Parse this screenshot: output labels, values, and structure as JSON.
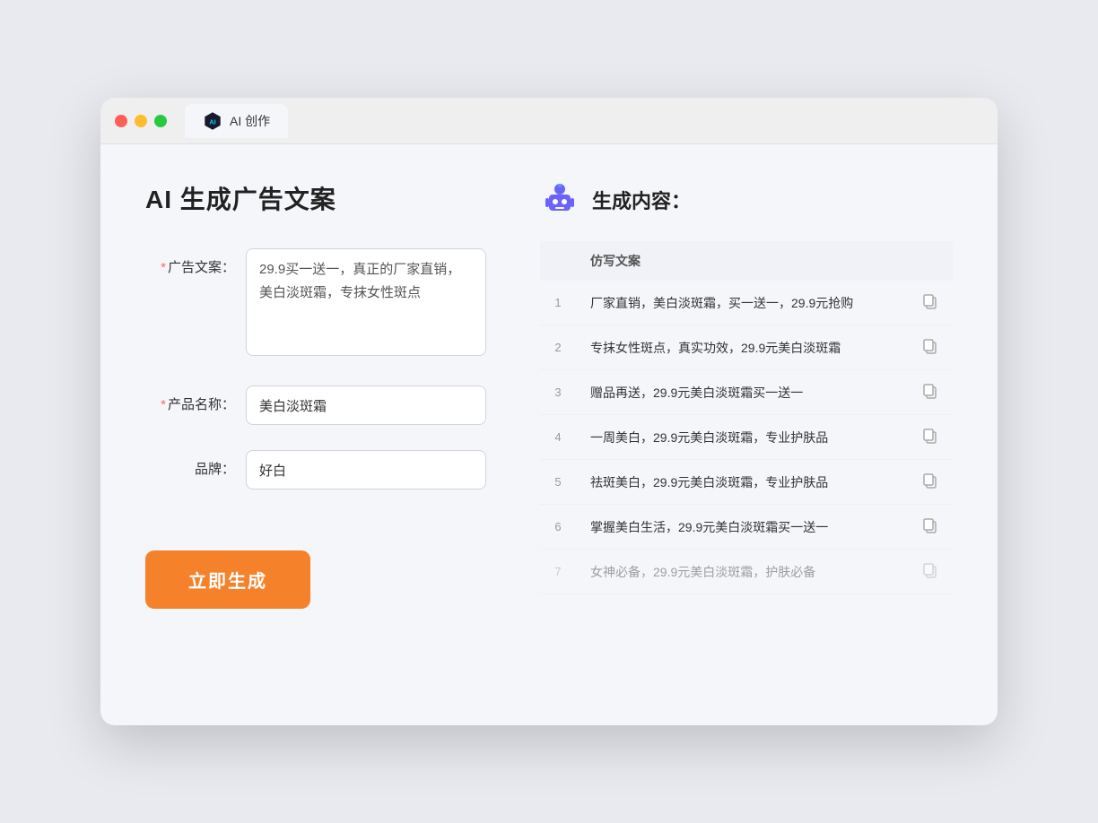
{
  "browser": {
    "tab_label": "AI 创作"
  },
  "left_panel": {
    "title": "AI 生成广告文案",
    "form": {
      "ad_copy_label": "广告文案：",
      "ad_copy_required": "*",
      "ad_copy_value": "29.9买一送一，真正的厂家直销，美白淡斑霜，专抹女性斑点",
      "product_name_label": "产品名称：",
      "product_name_required": "*",
      "product_name_value": "美白淡斑霜",
      "brand_label": "品牌：",
      "brand_value": "好白"
    },
    "generate_button": "立即生成"
  },
  "right_panel": {
    "title": "生成内容：",
    "table_header": "仿写文案",
    "results": [
      {
        "num": "1",
        "text": "厂家直销，美白淡斑霜，买一送一，29.9元抢购"
      },
      {
        "num": "2",
        "text": "专抹女性斑点，真实功效，29.9元美白淡斑霜"
      },
      {
        "num": "3",
        "text": "赠品再送，29.9元美白淡斑霜买一送一"
      },
      {
        "num": "4",
        "text": "一周美白，29.9元美白淡斑霜，专业护肤品"
      },
      {
        "num": "5",
        "text": "祛斑美白，29.9元美白淡斑霜，专业护肤品"
      },
      {
        "num": "6",
        "text": "掌握美白生活，29.9元美白淡斑霜买一送一"
      },
      {
        "num": "7",
        "text": "女神必备，29.9元美白淡斑霜，护肤必备"
      }
    ]
  }
}
